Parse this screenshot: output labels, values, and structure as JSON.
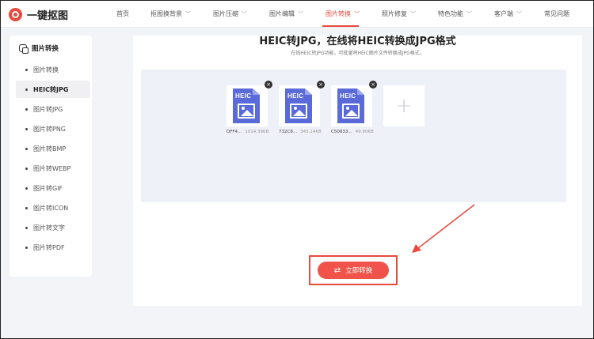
{
  "brand": {
    "name": "一键抠图"
  },
  "nav": [
    {
      "label": "首页",
      "chevron": false,
      "active": false
    },
    {
      "label": "抠图换背景",
      "chevron": true,
      "active": false
    },
    {
      "label": "图片压缩",
      "chevron": true,
      "active": false
    },
    {
      "label": "图片编辑",
      "chevron": true,
      "active": false
    },
    {
      "label": "图片转换",
      "chevron": true,
      "active": true
    },
    {
      "label": "照片修复",
      "chevron": true,
      "active": false
    },
    {
      "label": "特色功能",
      "chevron": true,
      "active": false
    },
    {
      "label": "客户端",
      "chevron": true,
      "active": false
    },
    {
      "label": "常见问题",
      "chevron": false,
      "active": false
    }
  ],
  "sidebar": {
    "title": "图片转换",
    "items": [
      {
        "label": "图片转换",
        "active": false
      },
      {
        "label": "HEIC转JPG",
        "active": true
      },
      {
        "label": "图片转JPG",
        "active": false
      },
      {
        "label": "图片转PNG",
        "active": false
      },
      {
        "label": "图片转BMP",
        "active": false
      },
      {
        "label": "图片转WEBP",
        "active": false
      },
      {
        "label": "图片转GIF",
        "active": false
      },
      {
        "label": "图片转ICON",
        "active": false
      },
      {
        "label": "图片转文字",
        "active": false
      },
      {
        "label": "图片转PDF",
        "active": false
      }
    ]
  },
  "main": {
    "title": "HEIC转JPG，在线将HEIC转换成JPG格式",
    "subtitle": "在线HEIC转JPG功能，可批量将HEIC图片文件转换成JPG格式。",
    "files": [
      {
        "badge": "HEIC",
        "name": "DFF4...",
        "size": "1014.39KB"
      },
      {
        "badge": "HEIC",
        "name": "732C8...",
        "size": "345.14KB"
      },
      {
        "badge": "HEIC",
        "name": "C50833...",
        "size": "49.90KB"
      }
    ],
    "add_symbol": "+",
    "remove_symbol": "×",
    "convert_label": "立即转换",
    "convert_icon": "⇄"
  },
  "colors": {
    "accent": "#e84a3f",
    "heic": "#5a6ad8",
    "upload_bg": "#eef1f7"
  }
}
